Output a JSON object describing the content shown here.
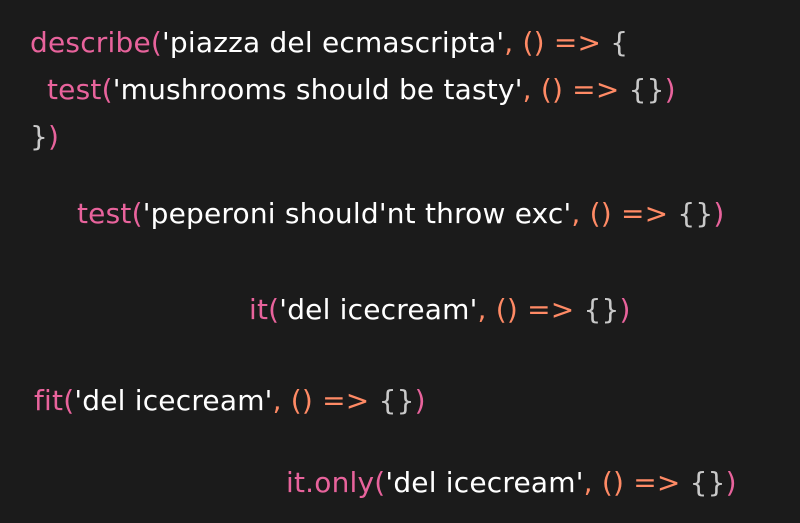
{
  "lines": [
    {
      "tokens": [
        {
          "kind": "fn",
          "text": "describe("
        },
        {
          "kind": "str",
          "text": "'piazza del ecmascripta'"
        },
        {
          "kind": "punc",
          "text": ", () => "
        },
        {
          "kind": "brace",
          "text": "{"
        }
      ]
    },
    {
      "tokens": [
        {
          "kind": "fn",
          "text": "test("
        },
        {
          "kind": "str",
          "text": "'mushrooms should be tasty'"
        },
        {
          "kind": "punc",
          "text": ", () => "
        },
        {
          "kind": "brace",
          "text": "{}"
        },
        {
          "kind": "fn",
          "text": ")"
        }
      ]
    },
    {
      "tokens": [
        {
          "kind": "brace",
          "text": "}"
        },
        {
          "kind": "fn",
          "text": ")"
        }
      ]
    },
    {
      "tokens": [
        {
          "kind": "fn",
          "text": "test("
        },
        {
          "kind": "str",
          "text": "'peperoni should'nt throw exc'"
        },
        {
          "kind": "punc",
          "text": ", () => "
        },
        {
          "kind": "brace",
          "text": "{}"
        },
        {
          "kind": "fn",
          "text": ")"
        }
      ]
    },
    {
      "tokens": [
        {
          "kind": "fn",
          "text": "it("
        },
        {
          "kind": "str",
          "text": "'del icecream'"
        },
        {
          "kind": "punc",
          "text": ", () => "
        },
        {
          "kind": "brace",
          "text": "{}"
        },
        {
          "kind": "fn",
          "text": ")"
        }
      ]
    },
    {
      "tokens": [
        {
          "kind": "fn",
          "text": "fit("
        },
        {
          "kind": "str",
          "text": "'del icecream'"
        },
        {
          "kind": "punc",
          "text": ", () => "
        },
        {
          "kind": "brace",
          "text": "{}"
        },
        {
          "kind": "fn",
          "text": ")"
        }
      ]
    },
    {
      "tokens": [
        {
          "kind": "fn",
          "text": "it.only("
        },
        {
          "kind": "str",
          "text": "'del icecream'"
        },
        {
          "kind": "punc",
          "text": ", () => "
        },
        {
          "kind": "brace",
          "text": "{}"
        },
        {
          "kind": "fn",
          "text": ")"
        }
      ]
    }
  ],
  "colors": {
    "background": "#1b1b1b",
    "function": "#e8639c",
    "string": "#ffffff",
    "operator": "#ff8a65",
    "brace": "#c9c9c9"
  }
}
